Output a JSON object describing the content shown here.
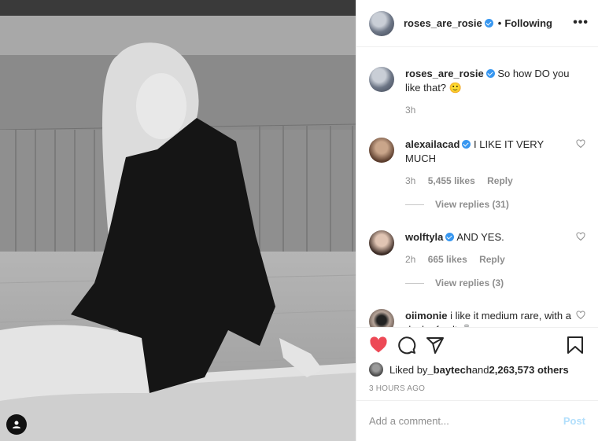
{
  "header": {
    "username": "roses_are_rosie",
    "separator": "•",
    "follow_label": "Following",
    "more_label": "•••"
  },
  "caption": {
    "username": "roses_are_rosie",
    "text": "So how DO you like that? 🙂",
    "time": "3h"
  },
  "comments": [
    {
      "username": "alexailacad",
      "verified": true,
      "text": "I LIKE IT VERY MUCH",
      "time": "3h",
      "likes": "5,455 likes",
      "reply_label": "Reply",
      "view_replies": "View replies (31)"
    },
    {
      "username": "wolftyla",
      "verified": true,
      "text": "AND YES.",
      "time": "2h",
      "likes": "665 likes",
      "reply_label": "Reply",
      "view_replies": "View replies (3)"
    },
    {
      "username": "oiimonie",
      "verified": false,
      "text": "i like it medium rare, with a dash of salt 🧂"
    }
  ],
  "liked_by": {
    "prefix": "Liked by ",
    "user": "_baytech",
    "middle": " and ",
    "others": "2,263,573 others"
  },
  "timestamp": "3 HOURS AGO",
  "add_comment": {
    "placeholder": "Add a comment...",
    "post_label": "Post"
  },
  "colors": {
    "like_red": "#ed4956",
    "verified_blue": "#3897f0",
    "post_blue": "#b2dffc"
  }
}
